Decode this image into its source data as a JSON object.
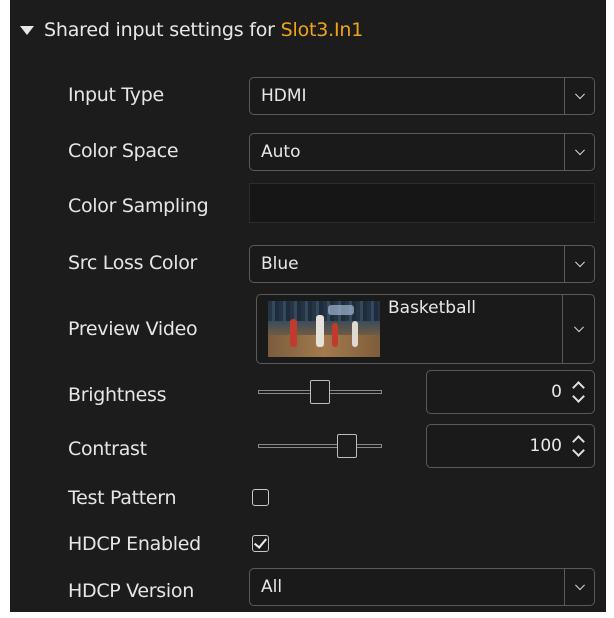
{
  "header": {
    "prefix": "Shared input settings for ",
    "slot": "Slot3.In1",
    "slot_color": "#f0a418"
  },
  "fields": {
    "input_type": {
      "label": "Input Type",
      "value": "HDMI"
    },
    "color_space": {
      "label": "Color Space",
      "value": "Auto"
    },
    "color_sampling": {
      "label": "Color Sampling",
      "value": ""
    },
    "src_loss_color": {
      "label": "Src Loss Color",
      "value": "Blue"
    },
    "preview_video": {
      "label": "Preview Video",
      "value": "Basketball"
    },
    "brightness": {
      "label": "Brightness",
      "value": "0",
      "slider_fraction": 0.5
    },
    "contrast": {
      "label": "Contrast",
      "value": "100",
      "slider_fraction": 0.72
    },
    "test_pattern": {
      "label": "Test Pattern",
      "checked": false
    },
    "hdcp_enabled": {
      "label": "HDCP Enabled",
      "checked": true
    },
    "hdcp_version": {
      "label": "HDCP Version",
      "value": "All"
    }
  },
  "icons": {
    "collapse": "caret-down-icon",
    "dropdown": "chevron-down-icon",
    "spinner": "spin-up-down-icon",
    "check": "check-icon"
  }
}
